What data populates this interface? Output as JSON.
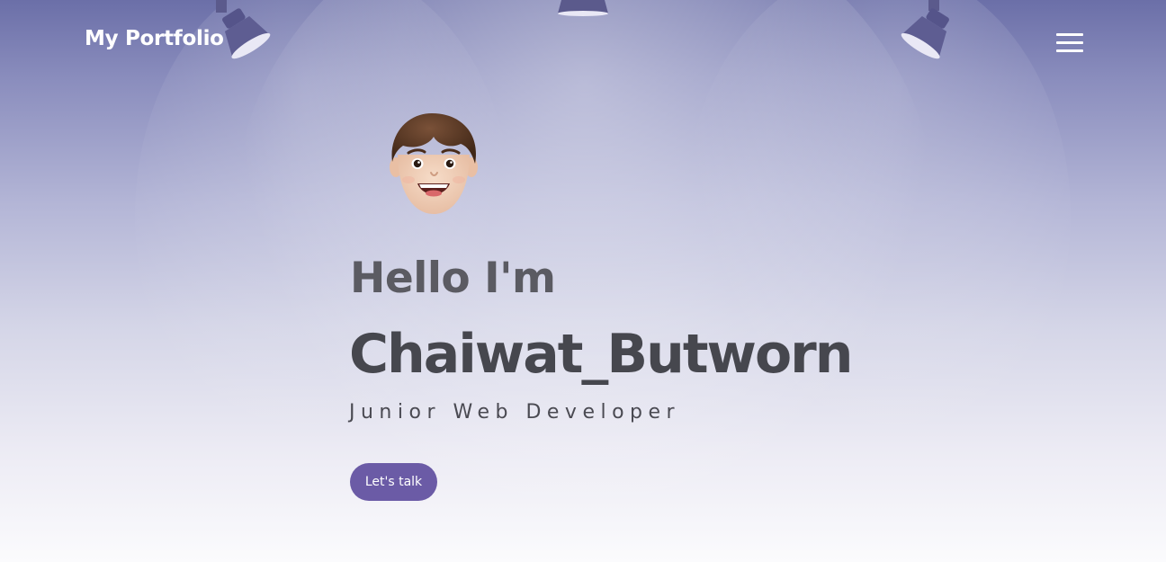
{
  "navbar": {
    "brand": "My Portfolio",
    "menu_icon": "hamburger-menu-icon"
  },
  "hero": {
    "avatar_icon": "memoji-avatar-icon",
    "greeting": "Hello I'm",
    "name": "Chaiwat_Butworn",
    "role": "Junior Web Developer",
    "cta_label": "Let's talk"
  },
  "decor": {
    "spotlight_icon": "spotlight-lamp-icon"
  },
  "colors": {
    "accent": "#6b5ba6",
    "name_text": "#46474e",
    "greeting_text": "#5b5b62",
    "background_top": "#6b6fa8",
    "background_bottom": "#fbfbfd",
    "lamp": "#5b5a8c"
  }
}
